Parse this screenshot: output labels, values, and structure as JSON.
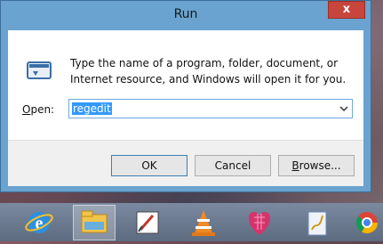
{
  "dialog": {
    "title": "Run",
    "close_label": "x",
    "description": "Type the name of a program, folder, document, or Internet resource, and Windows will open it for you.",
    "open_label_prefix": "O",
    "open_label_rest": "pen:",
    "open_value": "regedit",
    "ok_label": "OK",
    "cancel_label": "Cancel",
    "browse_label_prefix": "B",
    "browse_label_rest": "rowse..."
  },
  "taskbar": {
    "items": [
      {
        "icon": "internet-explorer-icon"
      },
      {
        "icon": "file-explorer-icon"
      },
      {
        "icon": "paint-icon"
      },
      {
        "icon": "vlc-icon"
      },
      {
        "icon": "heart-app-icon"
      },
      {
        "icon": "signature-app-icon"
      },
      {
        "icon": "chrome-icon"
      }
    ]
  },
  "colors": {
    "window_frame": "#6aa3cf",
    "close_button": "#c7453c",
    "selection": "#3399ff"
  }
}
